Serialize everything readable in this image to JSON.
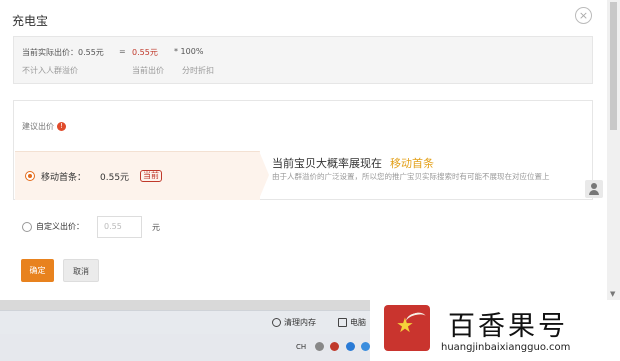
{
  "dialog": {
    "title": "充电宝",
    "close_glyph": "×"
  },
  "formula": {
    "actual_price_label": "当前实际出价：0.55元",
    "equals": "=",
    "current_price": "0.55元",
    "multiply": "* 100%",
    "sub_no_crowd": "不计入人群溢价",
    "sub_current": "当前出价",
    "sub_discount": "分时折扣"
  },
  "suggest": {
    "heading": "建议出价",
    "info_glyph": "!",
    "option_label": "移动首条：",
    "option_price": "0.55元",
    "option_tag": "当前",
    "desc_title": "当前宝贝大概率展现在",
    "desc_highlight": "移动首条",
    "desc_text": "由于人群溢价的广泛设置，所以您的推广宝贝实际搜索时有可能不展现在对应位置上"
  },
  "custom": {
    "label": "自定义出价：",
    "placeholder": "0.55",
    "unit": "元"
  },
  "buttons": {
    "ok": "确定",
    "cancel": "取消"
  },
  "taskbar": {
    "clean_memory": "清理内存",
    "computer": "电脑",
    "ime": "CH"
  },
  "watermark": {
    "name": "百香果号",
    "url": "huangjinbaixiangguo.com"
  },
  "colors": {
    "accent_orange": "#e8821e",
    "price_red": "#c0392b",
    "highlight_gold": "#e3a11b",
    "brand_red": "#c9342e"
  }
}
